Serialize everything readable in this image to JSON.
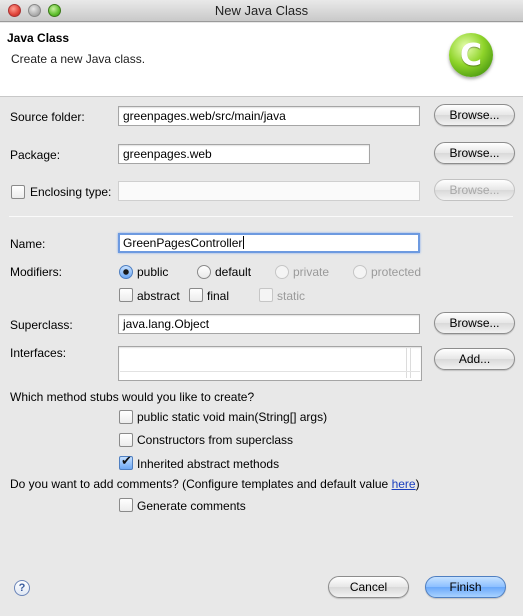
{
  "window": {
    "title": "New Java Class"
  },
  "header": {
    "title": "Java Class",
    "subtitle": "Create a new Java class.",
    "icon_letter": "C"
  },
  "form": {
    "source_folder": {
      "label": "Source folder:",
      "value": "greenpages.web/src/main/java",
      "browse": "Browse..."
    },
    "package": {
      "label": "Package:",
      "value": "greenpages.web",
      "browse": "Browse..."
    },
    "enclosing_type": {
      "label": "Enclosing type:",
      "value": "",
      "checked": false,
      "browse": "Browse..."
    },
    "name": {
      "label": "Name:",
      "value": "GreenPagesController"
    },
    "modifiers": {
      "label": "Modifiers:",
      "access": [
        "public",
        "default",
        "private",
        "protected"
      ],
      "selected_access": "public",
      "abstract": "abstract",
      "final": "final",
      "static": "static"
    },
    "superclass": {
      "label": "Superclass:",
      "value": "java.lang.Object",
      "browse": "Browse..."
    },
    "interfaces": {
      "label": "Interfaces:",
      "add": "Add..."
    },
    "stubs": {
      "question": "Which method stubs would you like to create?",
      "main": {
        "label": "public static void main(String[] args)",
        "checked": false
      },
      "constructors": {
        "label": "Constructors from superclass",
        "checked": false
      },
      "inherited": {
        "label": "Inherited abstract methods",
        "checked": true
      }
    },
    "comments": {
      "question": "Do you want to add comments? (Configure templates and default value ",
      "link": "here",
      "close": ")",
      "generate": {
        "label": "Generate comments",
        "checked": false
      }
    }
  },
  "footer": {
    "help": "?",
    "cancel": "Cancel",
    "finish": "Finish"
  }
}
